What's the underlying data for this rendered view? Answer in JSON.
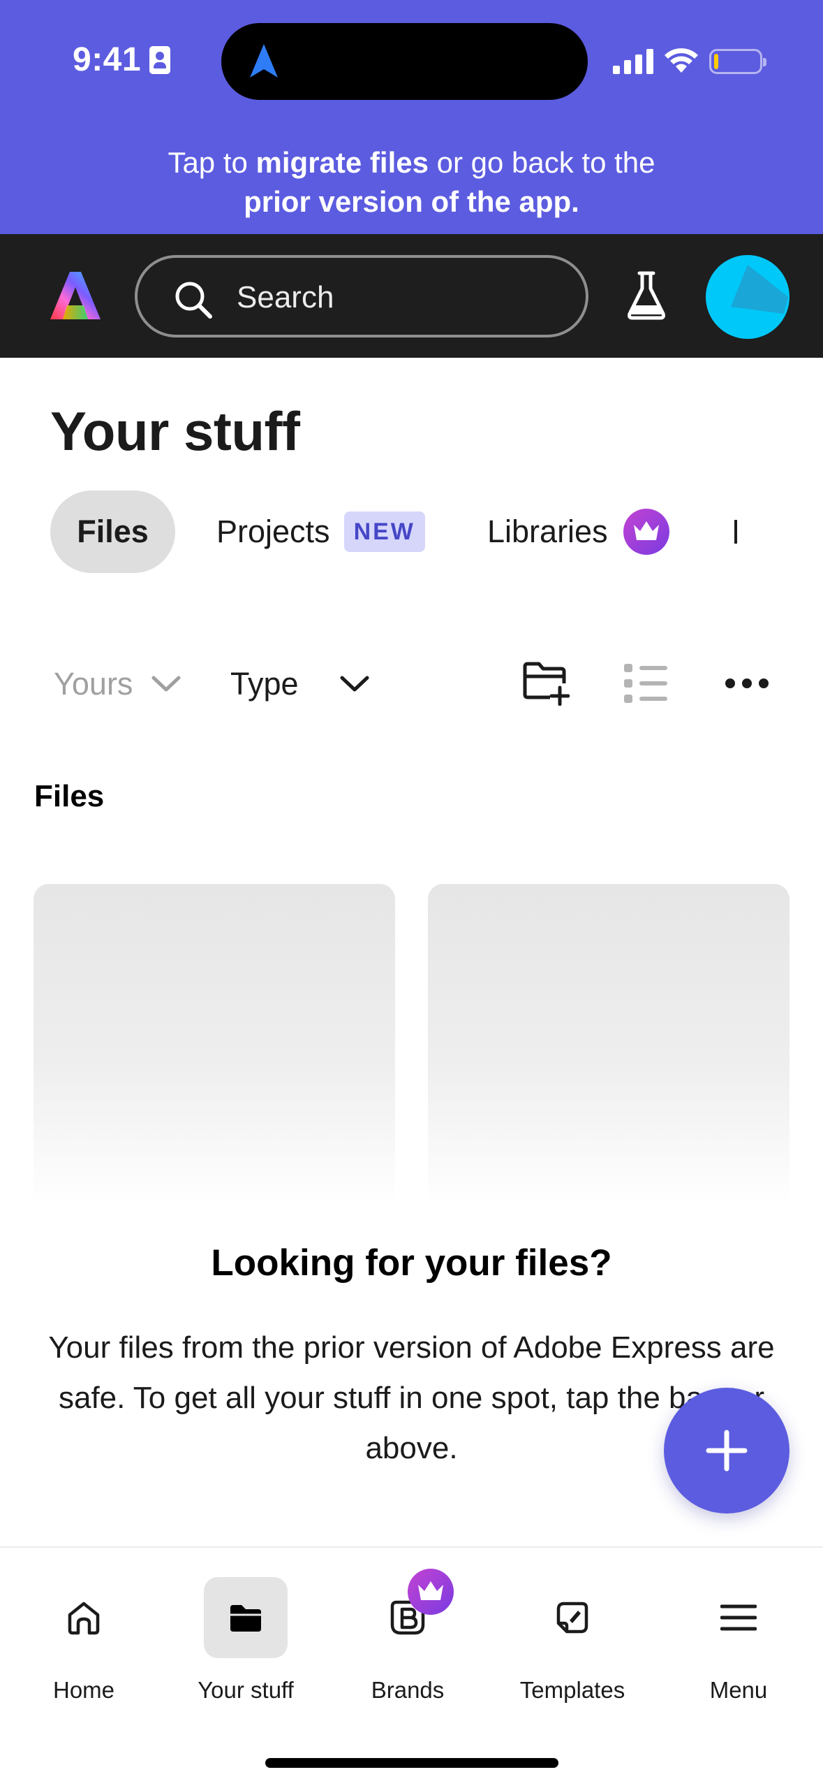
{
  "status_bar": {
    "time": "9:41",
    "icons": [
      "id-badge-icon",
      "navigation-arrow-icon",
      "signal-icon",
      "wifi-icon",
      "battery-icon"
    ],
    "battery_level": 0.1
  },
  "banner": {
    "line1_prefix": "Tap to ",
    "line1_bold": "migrate files",
    "line1_suffix": " or go back to the",
    "line2_bold": "prior version of the app."
  },
  "header": {
    "search_placeholder": "Search",
    "icons": [
      "adobe-express-logo",
      "search-icon",
      "labs-flask-icon",
      "avatar"
    ]
  },
  "page": {
    "title": "Your stuff",
    "tabs": [
      {
        "label": "Files",
        "selected": true
      },
      {
        "label": "Projects",
        "badge": "NEW"
      },
      {
        "label": "Libraries",
        "badge_icon": "crown-icon"
      },
      {
        "label": "I"
      }
    ],
    "filters": {
      "owner": "Yours",
      "type": "Type"
    },
    "section_title": "Files",
    "empty_state": {
      "title": "Looking for your files?",
      "body": "Your files from the prior version of Adobe Express are safe. To get all your stuff in one spot, tap the banner above."
    }
  },
  "bottom_nav": {
    "items": [
      {
        "label": "Home",
        "icon": "home-icon"
      },
      {
        "label": "Your stuff",
        "icon": "folder-icon",
        "active": true
      },
      {
        "label": "Brands",
        "icon": "brand-icon",
        "badge_icon": "crown-icon"
      },
      {
        "label": "Templates",
        "icon": "templates-icon"
      },
      {
        "label": "Menu",
        "icon": "menu-icon"
      }
    ]
  },
  "colors": {
    "accent": "#5c5ce0",
    "header_bg": "#1e1e1e",
    "avatar": "#00c8f8",
    "new_badge_bg": "#d6d6fb",
    "new_badge_text": "#4646c8"
  }
}
